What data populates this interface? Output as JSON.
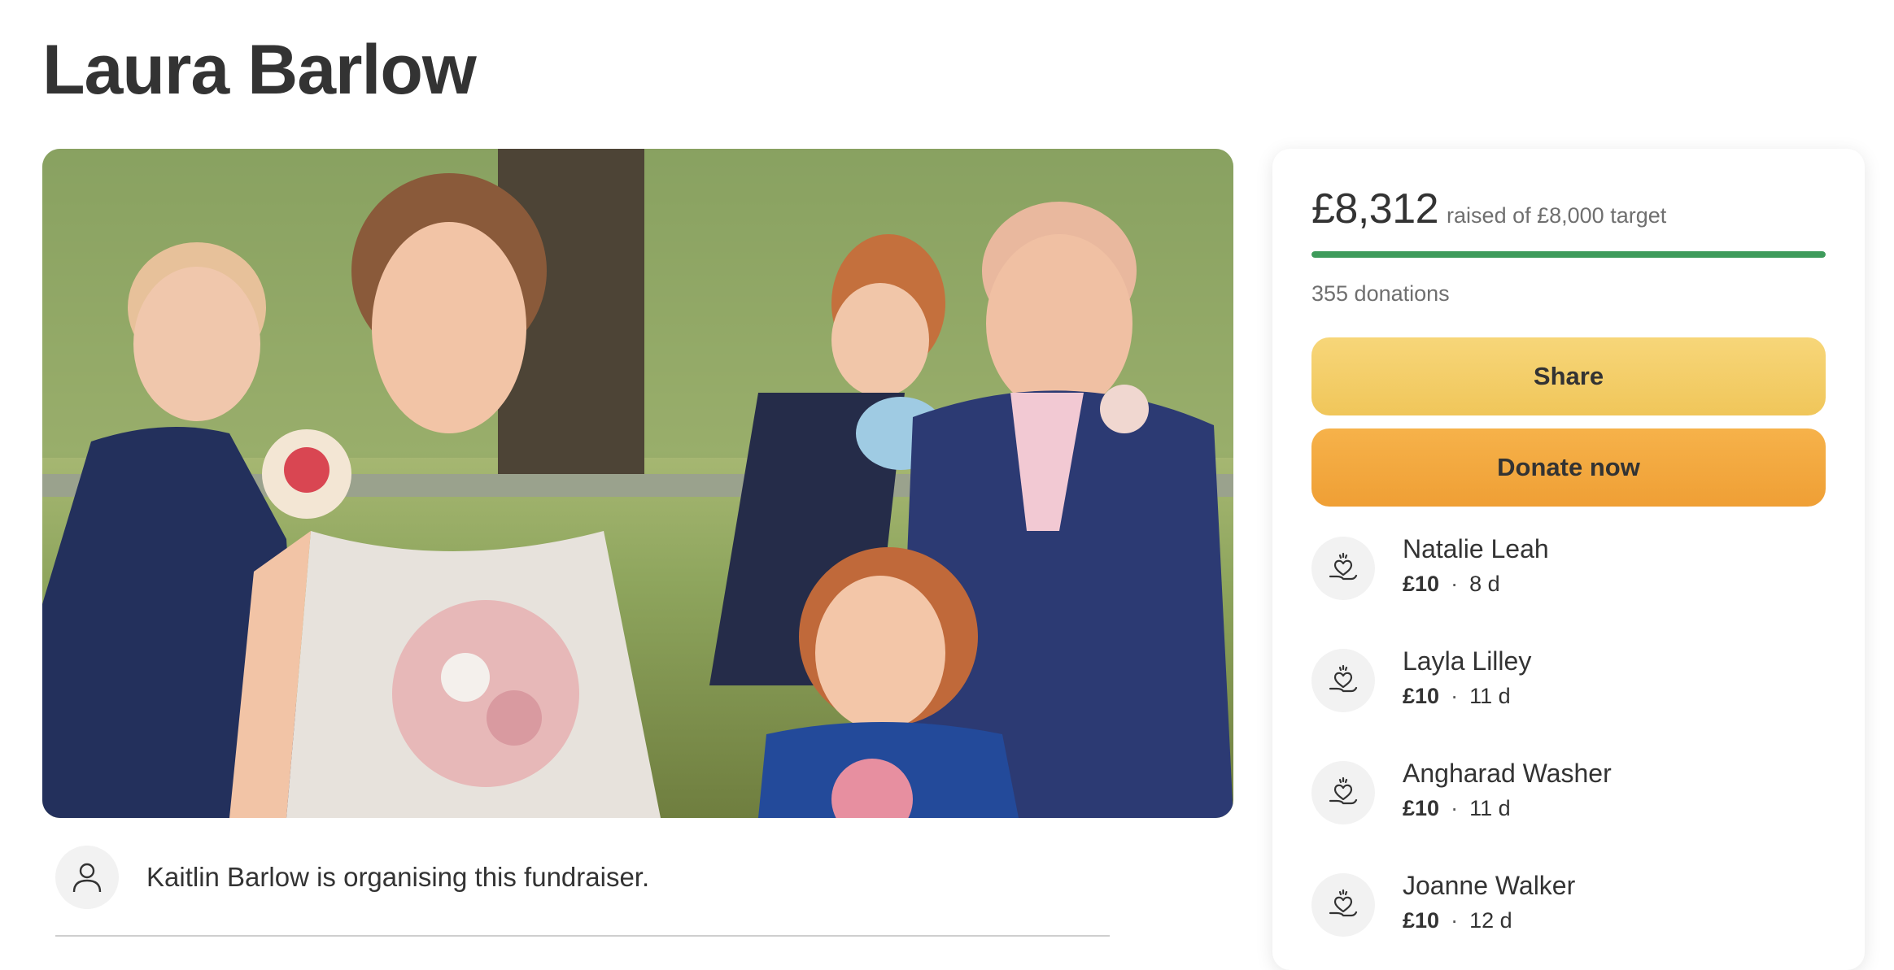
{
  "title": "Laura Barlow",
  "hero_image": {
    "alt_icon": "family-photo"
  },
  "organiser": {
    "icon": "person-icon",
    "text": "Kaitlin Barlow is organising this fundraiser."
  },
  "card": {
    "raised": "£8,312",
    "raised_of": "raised of £8,000 target",
    "progress_fraction": 1.0,
    "donations": "355 donations",
    "share_label": "Share",
    "donate_label": "Donate now",
    "accent_colors": {
      "progress": "#3e9b5b",
      "share": "#f0c65a",
      "donate": "#ef9f35"
    },
    "donors": [
      {
        "name": "Natalie Leah",
        "amount": "£10",
        "time": "8 d"
      },
      {
        "name": "Layla Lilley",
        "amount": "£10",
        "time": "11 d"
      },
      {
        "name": "Angharad Washer",
        "amount": "£10",
        "time": "11 d"
      },
      {
        "name": "Joanne Walker",
        "amount": "£10",
        "time": "12 d"
      }
    ]
  }
}
